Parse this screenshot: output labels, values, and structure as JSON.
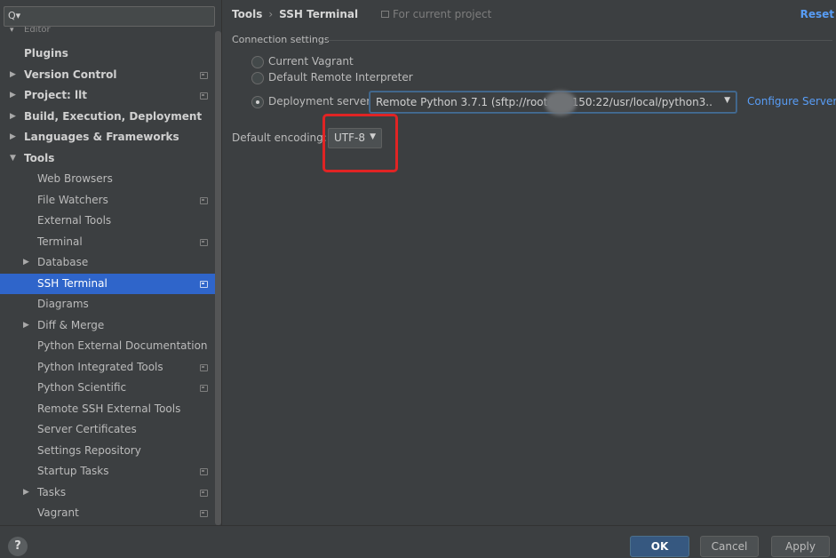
{
  "search": {
    "placeholder": "",
    "icon": "search-icon"
  },
  "sidebar": {
    "cut_item": "Editor",
    "items": [
      {
        "label": "Plugins"
      },
      {
        "label": "Version Control"
      },
      {
        "label": "Project: llt"
      },
      {
        "label": "Build, Execution, Deployment"
      },
      {
        "label": "Languages & Frameworks"
      },
      {
        "label": "Tools"
      },
      {
        "label": "Web Browsers"
      },
      {
        "label": "File Watchers"
      },
      {
        "label": "External Tools"
      },
      {
        "label": "Terminal"
      },
      {
        "label": "Database"
      },
      {
        "label": "SSH Terminal"
      },
      {
        "label": "Diagrams"
      },
      {
        "label": "Diff & Merge"
      },
      {
        "label": "Python External Documentation"
      },
      {
        "label": "Python Integrated Tools"
      },
      {
        "label": "Python Scientific"
      },
      {
        "label": "Remote SSH External Tools"
      },
      {
        "label": "Server Certificates"
      },
      {
        "label": "Settings Repository"
      },
      {
        "label": "Startup Tasks"
      },
      {
        "label": "Tasks"
      },
      {
        "label": "Vagrant"
      }
    ]
  },
  "header": {
    "crumb_parent": "Tools",
    "crumb_current": "SSH Terminal",
    "scope": "For current project",
    "reset": "Reset"
  },
  "connection": {
    "section_label": "Connection settings",
    "option_vagrant": "Current Vagrant",
    "option_remote": "Default Remote Interpreter",
    "option_deploy": "Deployment server",
    "server_value": "Remote Python 3.7.1 (sftp://root@          0.150:22/usr/local/python3...",
    "configure": "Configure Servers"
  },
  "encoding": {
    "label": "Default encoding:",
    "value": "UTF-8"
  },
  "footer": {
    "help": "?",
    "ok": "OK",
    "cancel": "Cancel",
    "apply": "Apply"
  },
  "colors": {
    "background": "#3c3f41",
    "selection": "#2f65ca",
    "link": "#589df6",
    "primary_button": "#365880",
    "highlight": "#e02424"
  }
}
